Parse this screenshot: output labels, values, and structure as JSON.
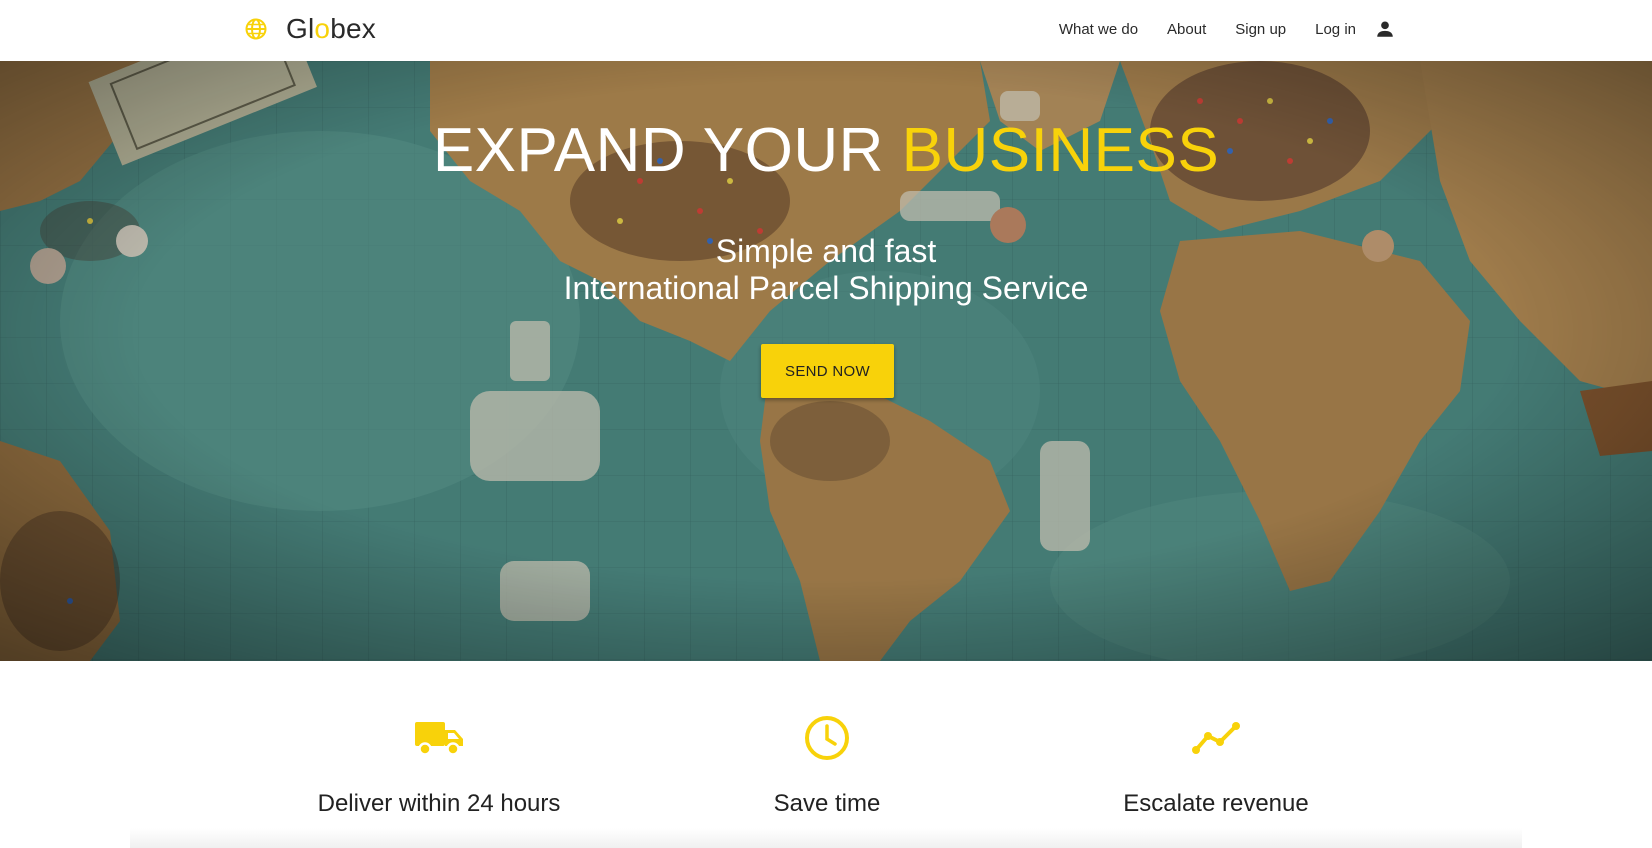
{
  "brand": {
    "name_before": "Gl",
    "name_o": "o",
    "name_after": "bex",
    "icon": "globe-icon",
    "accent_color": "#f8d20a"
  },
  "nav": {
    "items": [
      {
        "label": "What we do"
      },
      {
        "label": "About"
      },
      {
        "label": "Sign up"
      },
      {
        "label": "Log in"
      }
    ],
    "user_icon": "person-icon"
  },
  "hero": {
    "title_main": "EXPAND YOUR ",
    "title_accent": "BUSINESS",
    "subtitle_line1": "Simple and fast",
    "subtitle_line2": "International Parcel Shipping Service",
    "cta_label": "SEND NOW",
    "background": "world-map-with-pins-photo"
  },
  "features": [
    {
      "icon": "truck-icon",
      "label": "Deliver within 24 hours"
    },
    {
      "icon": "clock-icon",
      "label": "Save time"
    },
    {
      "icon": "trending-up-icon",
      "label": "Escalate revenue"
    }
  ]
}
